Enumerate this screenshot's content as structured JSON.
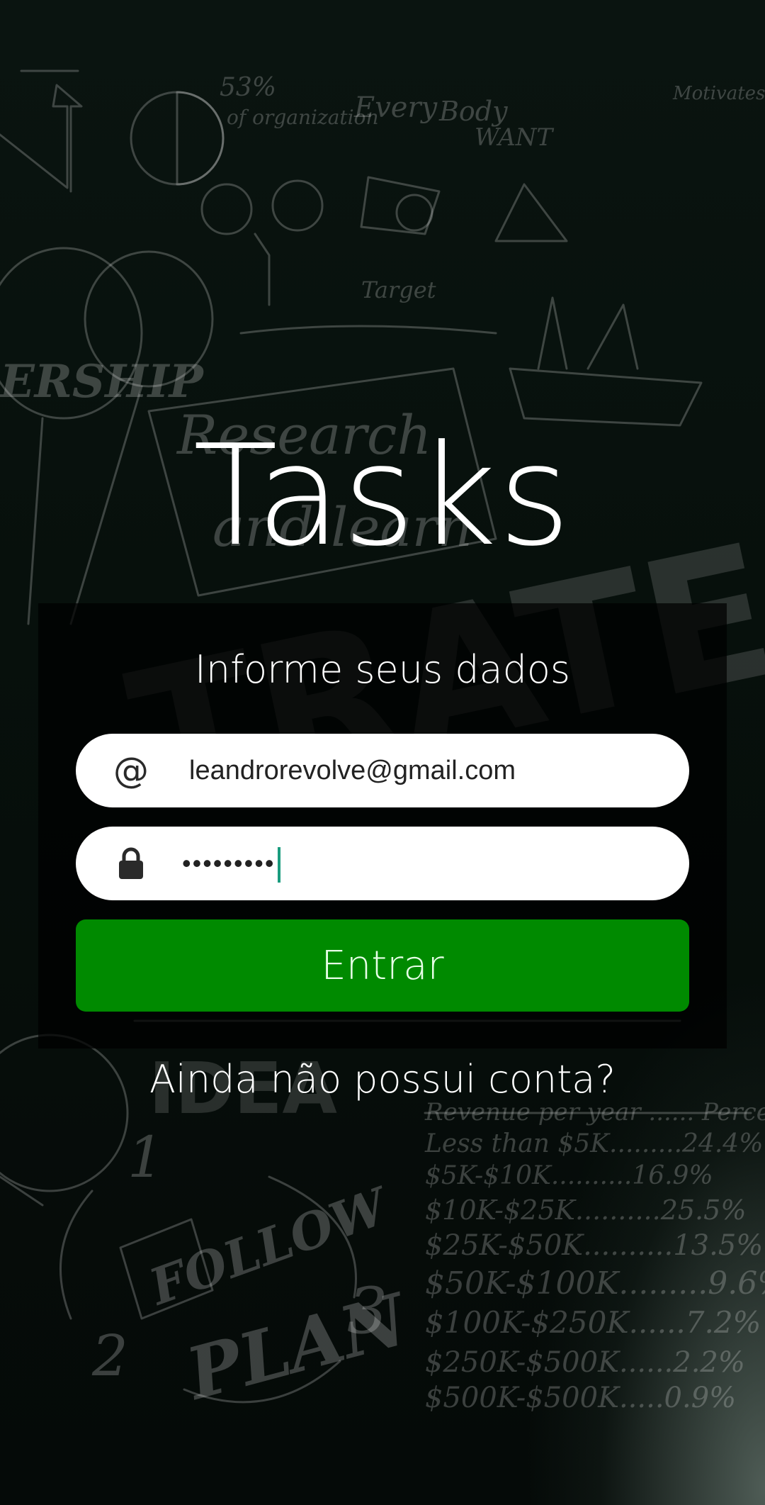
{
  "app": {
    "title": "Tasks"
  },
  "login_form": {
    "heading": "Informe seus dados",
    "email": {
      "icon": "at-sign-icon",
      "icon_glyph": "@",
      "value": "leandrorevolve@gmail.com"
    },
    "password": {
      "icon": "lock-icon",
      "masked_value": "•••••••••"
    },
    "submit_label": "Entrar",
    "signup_link": "Ainda não possui conta?"
  },
  "colors": {
    "button_green": "#008a00",
    "caret": "#1a9c7e",
    "field_background": "#ffffff"
  }
}
